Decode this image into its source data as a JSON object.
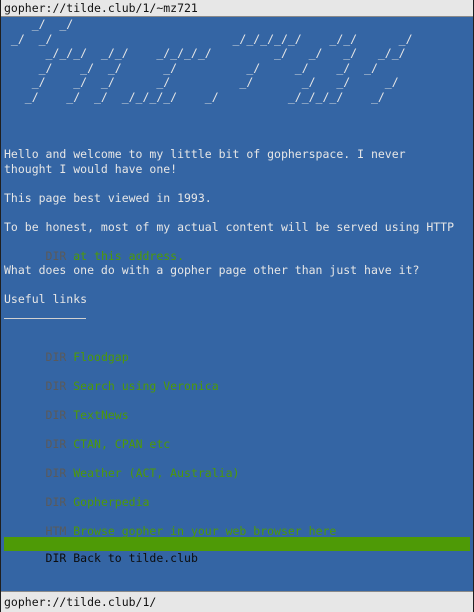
{
  "window": {
    "title": "gopher://tilde.club/1/~mz721",
    "status": "gopher://tilde.club/1/"
  },
  "banner": {
    "ascii": "    _/  _/\n _/  _/                          _/_/_/_/_/    _/_/      _/\n      _/_/_/  _/_/    _/_/_/_/         _/   _/   _/   _/_/\n     _/    _/  _/      _/          _/     _/    _/  _/\n    _/    _/  _/      _/          _/       _/   _/     _/\n   _/    _/  _/  _/_/_/_/    _/          _/_/_/_/    _/"
  },
  "paragraphs": {
    "welcome_1": "Hello and welcome to my little bit of gopherspace. I never",
    "welcome_2": "thought I would have one!",
    "best_viewed": "This page best viewed in 1993.",
    "honest": "To be honest, most of my actual content will be served using HTTP",
    "question": "What does one do with a gopher page other than just have it?",
    "useful_links": "Useful links"
  },
  "links": {
    "address": {
      "tag": "DIR",
      "text": " at this address."
    },
    "items": [
      {
        "tag": "DIR",
        "text": " Floodgap"
      },
      {
        "tag": "DIR",
        "text": " Search using Veronica"
      },
      {
        "tag": "DIR",
        "text": " TextNews"
      },
      {
        "tag": "DIR",
        "text": " CTAN, CPAN etc"
      },
      {
        "tag": "DIR",
        "text": " Weather (ACT, Australia)"
      },
      {
        "tag": "DIR",
        "text": " Gopherpedia"
      },
      {
        "tag": "HTM",
        "text": " Browse gopher in your web browser here"
      }
    ],
    "selected": {
      "tag": "DIR",
      "text": " Back to tilde.club"
    }
  },
  "colors": {
    "background": "#3465a4",
    "link": "#4e9a06",
    "tag": "#5a5a5a",
    "text": "#e6e6e6",
    "selected_bar": "#4e9a06"
  }
}
